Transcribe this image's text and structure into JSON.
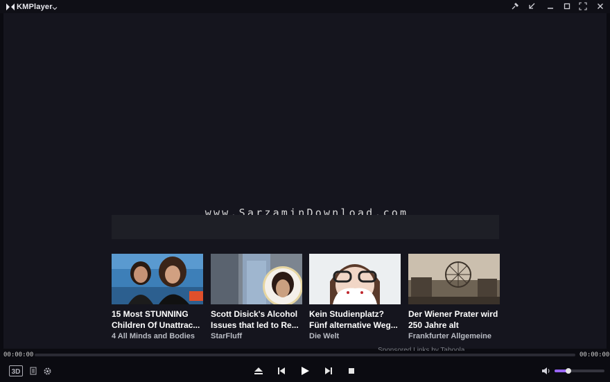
{
  "titlebar": {
    "app_name": "KMPlayer",
    "buttons": [
      "pin-icon",
      "minimize-to-corner-icon",
      "minimize-icon",
      "maximize-icon",
      "fullscreen-icon",
      "close-icon"
    ]
  },
  "video": {
    "watermark": "www.SarzaminDownload.com"
  },
  "ads": {
    "cards": [
      {
        "title_line1": "15 Most STUNNING",
        "title_line2": "Children Of Unattrac...",
        "source": "4 All Minds and Bodies"
      },
      {
        "title_line1": "Scott Disick's Alcohol",
        "title_line2": "Issues that led to Re...",
        "source": "StarFluff"
      },
      {
        "title_line1": "Kein Studienplatz?",
        "title_line2": "Fünf alternative Weg...",
        "source": "Die Welt"
      },
      {
        "title_line1": "Der Wiener Prater wird",
        "title_line2": "250 Jahre alt",
        "source": "Frankfurter Allgemeine"
      }
    ],
    "sponsored_text": "Sponsored Links by Taboola"
  },
  "player": {
    "time_elapsed": "00:00:00",
    "time_total": "00:00:00",
    "seek_progress": 0,
    "volume_level": 0.28,
    "accent_color": "#9a66ff",
    "left_buttons": [
      "3d-icon",
      "playlist-icon",
      "settings-gear-icon"
    ],
    "center_buttons": [
      "eject-icon",
      "previous-icon",
      "play-icon",
      "next-icon",
      "stop-icon"
    ],
    "right_buttons": [
      "volume-icon"
    ]
  }
}
